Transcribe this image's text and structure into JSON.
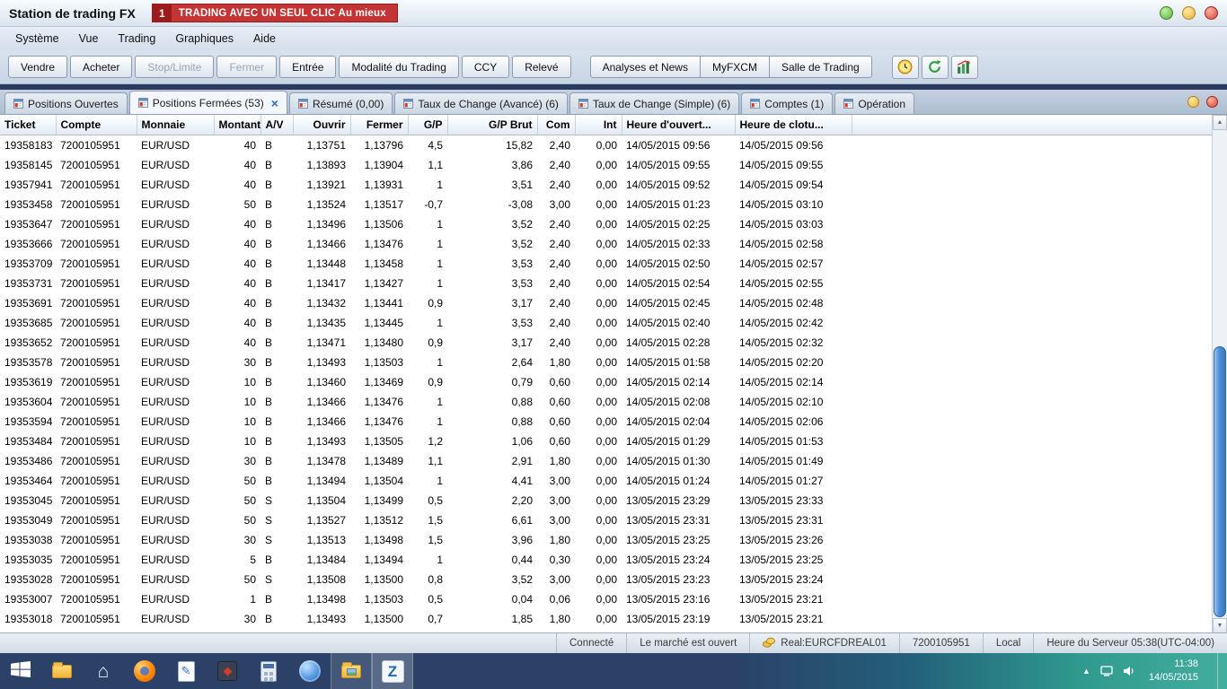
{
  "window": {
    "title": "Station de trading FX"
  },
  "banner": {
    "badge": "1",
    "text": "TRADING AVEC UN SEUL CLIC Au mieux"
  },
  "menu": {
    "items": [
      "Système",
      "Vue",
      "Trading",
      "Graphiques",
      "Aide"
    ]
  },
  "toolbar": {
    "primary": [
      {
        "label": "Vendre",
        "enabled": true
      },
      {
        "label": "Acheter",
        "enabled": true
      },
      {
        "label": "Stop/Limite",
        "enabled": false
      },
      {
        "label": "Fermer",
        "enabled": false
      },
      {
        "label": "Entrée",
        "enabled": true
      },
      {
        "label": "Modalité du Trading",
        "enabled": true
      },
      {
        "label": "CCY",
        "enabled": true
      },
      {
        "label": "Relevé",
        "enabled": true
      }
    ],
    "secondary": [
      "Analyses et News",
      "MyFXCM",
      "Salle de Trading"
    ],
    "icon_buttons": [
      "clock-icon",
      "refresh-icon",
      "chart-icon"
    ]
  },
  "tabs": [
    {
      "label": "Positions Ouvertes",
      "active": false,
      "closable": false
    },
    {
      "label": "Positions Fermées (53)",
      "active": true,
      "closable": true
    },
    {
      "label": "Résumé (0,00)",
      "active": false,
      "closable": false
    },
    {
      "label": "Taux de Change (Avancé) (6)",
      "active": false,
      "closable": false
    },
    {
      "label": "Taux de Change (Simple) (6)",
      "active": false,
      "closable": false
    },
    {
      "label": "Comptes (1)",
      "active": false,
      "closable": false
    },
    {
      "label": "Opération",
      "active": false,
      "closable": false
    }
  ],
  "table": {
    "columns": [
      "Ticket",
      "Compte",
      "Monnaie",
      "Montant",
      "A/V",
      "Ouvrir",
      "Fermer",
      "G/P",
      "G/P Brut",
      "Com",
      "Int",
      "Heure d'ouvert...",
      "Heure de clotu..."
    ],
    "rows": [
      [
        "19358183",
        "7200105951",
        "EUR/USD",
        "40",
        "B",
        "1,13751",
        "1,13796",
        "4,5",
        "15,82",
        "2,40",
        "0,00",
        "14/05/2015 09:56",
        "14/05/2015 09:56"
      ],
      [
        "19358145",
        "7200105951",
        "EUR/USD",
        "40",
        "B",
        "1,13893",
        "1,13904",
        "1,1",
        "3,86",
        "2,40",
        "0,00",
        "14/05/2015 09:55",
        "14/05/2015 09:55"
      ],
      [
        "19357941",
        "7200105951",
        "EUR/USD",
        "40",
        "B",
        "1,13921",
        "1,13931",
        "1",
        "3,51",
        "2,40",
        "0,00",
        "14/05/2015 09:52",
        "14/05/2015 09:54"
      ],
      [
        "19353458",
        "7200105951",
        "EUR/USD",
        "50",
        "B",
        "1,13524",
        "1,13517",
        "-0,7",
        "-3,08",
        "3,00",
        "0,00",
        "14/05/2015 01:23",
        "14/05/2015 03:10"
      ],
      [
        "19353647",
        "7200105951",
        "EUR/USD",
        "40",
        "B",
        "1,13496",
        "1,13506",
        "1",
        "3,52",
        "2,40",
        "0,00",
        "14/05/2015 02:25",
        "14/05/2015 03:03"
      ],
      [
        "19353666",
        "7200105951",
        "EUR/USD",
        "40",
        "B",
        "1,13466",
        "1,13476",
        "1",
        "3,52",
        "2,40",
        "0,00",
        "14/05/2015 02:33",
        "14/05/2015 02:58"
      ],
      [
        "19353709",
        "7200105951",
        "EUR/USD",
        "40",
        "B",
        "1,13448",
        "1,13458",
        "1",
        "3,53",
        "2,40",
        "0,00",
        "14/05/2015 02:50",
        "14/05/2015 02:57"
      ],
      [
        "19353731",
        "7200105951",
        "EUR/USD",
        "40",
        "B",
        "1,13417",
        "1,13427",
        "1",
        "3,53",
        "2,40",
        "0,00",
        "14/05/2015 02:54",
        "14/05/2015 02:55"
      ],
      [
        "19353691",
        "7200105951",
        "EUR/USD",
        "40",
        "B",
        "1,13432",
        "1,13441",
        "0,9",
        "3,17",
        "2,40",
        "0,00",
        "14/05/2015 02:45",
        "14/05/2015 02:48"
      ],
      [
        "19353685",
        "7200105951",
        "EUR/USD",
        "40",
        "B",
        "1,13435",
        "1,13445",
        "1",
        "3,53",
        "2,40",
        "0,00",
        "14/05/2015 02:40",
        "14/05/2015 02:42"
      ],
      [
        "19353652",
        "7200105951",
        "EUR/USD",
        "40",
        "B",
        "1,13471",
        "1,13480",
        "0,9",
        "3,17",
        "2,40",
        "0,00",
        "14/05/2015 02:28",
        "14/05/2015 02:32"
      ],
      [
        "19353578",
        "7200105951",
        "EUR/USD",
        "30",
        "B",
        "1,13493",
        "1,13503",
        "1",
        "2,64",
        "1,80",
        "0,00",
        "14/05/2015 01:58",
        "14/05/2015 02:20"
      ],
      [
        "19353619",
        "7200105951",
        "EUR/USD",
        "10",
        "B",
        "1,13460",
        "1,13469",
        "0,9",
        "0,79",
        "0,60",
        "0,00",
        "14/05/2015 02:14",
        "14/05/2015 02:14"
      ],
      [
        "19353604",
        "7200105951",
        "EUR/USD",
        "10",
        "B",
        "1,13466",
        "1,13476",
        "1",
        "0,88",
        "0,60",
        "0,00",
        "14/05/2015 02:08",
        "14/05/2015 02:10"
      ],
      [
        "19353594",
        "7200105951",
        "EUR/USD",
        "10",
        "B",
        "1,13466",
        "1,13476",
        "1",
        "0,88",
        "0,60",
        "0,00",
        "14/05/2015 02:04",
        "14/05/2015 02:06"
      ],
      [
        "19353484",
        "7200105951",
        "EUR/USD",
        "10",
        "B",
        "1,13493",
        "1,13505",
        "1,2",
        "1,06",
        "0,60",
        "0,00",
        "14/05/2015 01:29",
        "14/05/2015 01:53"
      ],
      [
        "19353486",
        "7200105951",
        "EUR/USD",
        "30",
        "B",
        "1,13478",
        "1,13489",
        "1,1",
        "2,91",
        "1,80",
        "0,00",
        "14/05/2015 01:30",
        "14/05/2015 01:49"
      ],
      [
        "19353464",
        "7200105951",
        "EUR/USD",
        "50",
        "B",
        "1,13494",
        "1,13504",
        "1",
        "4,41",
        "3,00",
        "0,00",
        "14/05/2015 01:24",
        "14/05/2015 01:27"
      ],
      [
        "19353045",
        "7200105951",
        "EUR/USD",
        "50",
        "S",
        "1,13504",
        "1,13499",
        "0,5",
        "2,20",
        "3,00",
        "0,00",
        "13/05/2015 23:29",
        "13/05/2015 23:33"
      ],
      [
        "19353049",
        "7200105951",
        "EUR/USD",
        "50",
        "S",
        "1,13527",
        "1,13512",
        "1,5",
        "6,61",
        "3,00",
        "0,00",
        "13/05/2015 23:31",
        "13/05/2015 23:31"
      ],
      [
        "19353038",
        "7200105951",
        "EUR/USD",
        "30",
        "S",
        "1,13513",
        "1,13498",
        "1,5",
        "3,96",
        "1,80",
        "0,00",
        "13/05/2015 23:25",
        "13/05/2015 23:26"
      ],
      [
        "19353035",
        "7200105951",
        "EUR/USD",
        "5",
        "B",
        "1,13484",
        "1,13494",
        "1",
        "0,44",
        "0,30",
        "0,00",
        "13/05/2015 23:24",
        "13/05/2015 23:25"
      ],
      [
        "19353028",
        "7200105951",
        "EUR/USD",
        "50",
        "S",
        "1,13508",
        "1,13500",
        "0,8",
        "3,52",
        "3,00",
        "0,00",
        "13/05/2015 23:23",
        "13/05/2015 23:24"
      ],
      [
        "19353007",
        "7200105951",
        "EUR/USD",
        "1",
        "B",
        "1,13498",
        "1,13503",
        "0,5",
        "0,04",
        "0,06",
        "0,00",
        "13/05/2015 23:16",
        "13/05/2015 23:21"
      ],
      [
        "19353018",
        "7200105951",
        "EUR/USD",
        "30",
        "B",
        "1,13493",
        "1,13500",
        "0,7",
        "1,85",
        "1,80",
        "0,00",
        "13/05/2015 23:19",
        "13/05/2015 23:21"
      ]
    ]
  },
  "status": {
    "connection": "Connecté",
    "market": "Le marché est ouvert",
    "account_server": "Real:EURCFDREAL01",
    "account": "7200105951",
    "mode": "Local",
    "server_time": "Heure du Serveur 05:38(UTC-04:00)"
  },
  "taskbar": {
    "time": "11:38",
    "date": "14/05/2015",
    "apps": [
      "start",
      "file-explorer",
      "home",
      "firefox",
      "notepad",
      "utility-app",
      "calculator",
      "browser-globe",
      "pictures-folder",
      "trading-station"
    ],
    "tray": [
      "hidden-icons",
      "display",
      "volume"
    ]
  },
  "glyphs": {
    "close": "×",
    "up_arrow": "▲",
    "down_arrow": "▼",
    "home": "⌂",
    "pen": "✎",
    "z": "Z"
  }
}
